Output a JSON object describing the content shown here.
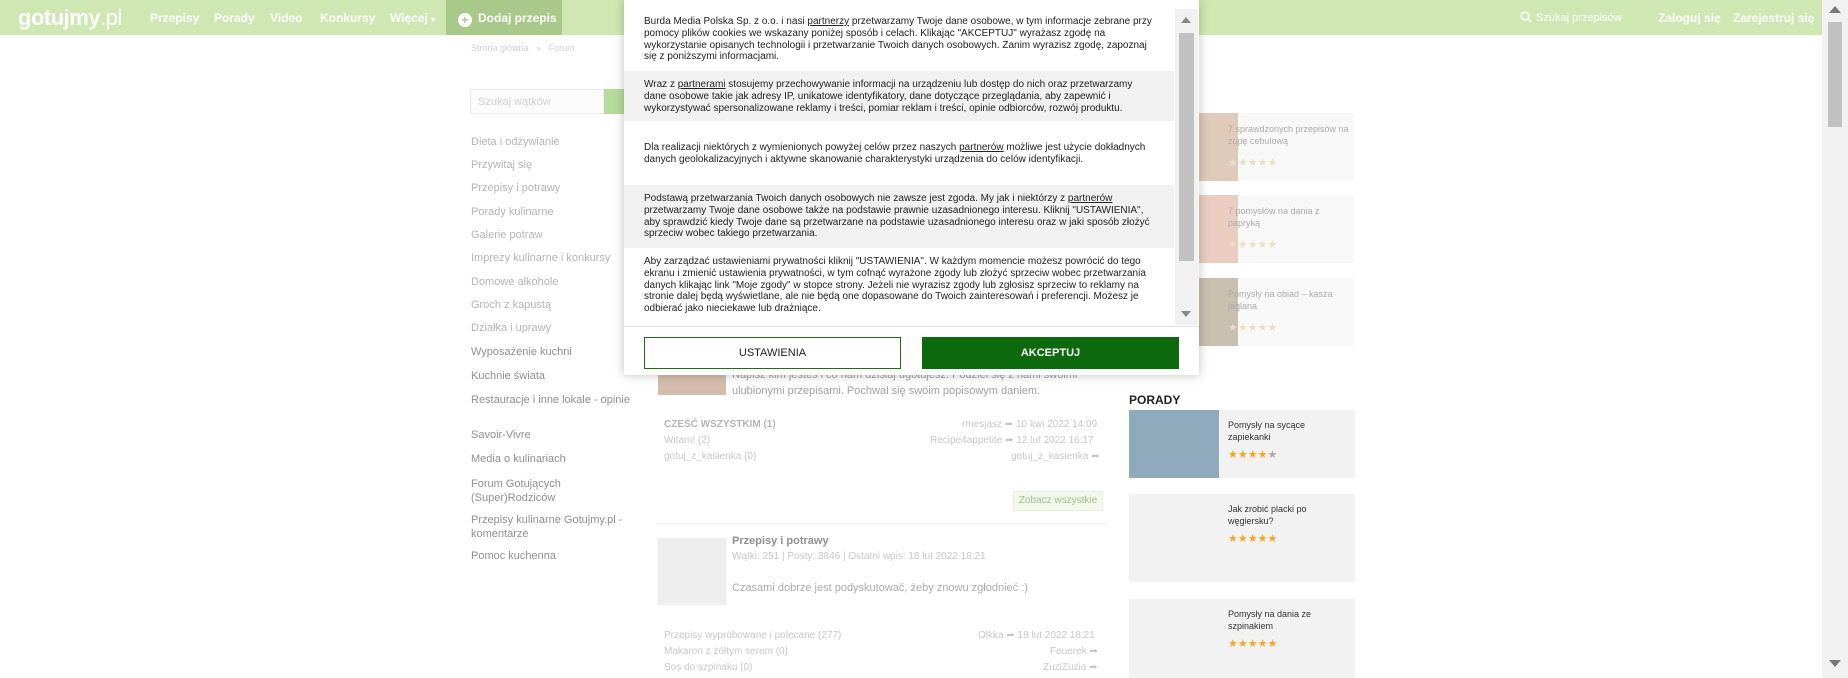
{
  "header": {
    "logo_main": "gotujmy",
    "logo_suffix": ".pl",
    "nav": [
      "Przepisy",
      "Porady",
      "Video",
      "Konkursy",
      "Więcej"
    ],
    "add_recipe": "Dodaj przepis",
    "search_placeholder": "Szukaj przepisów",
    "login": "Zaloguj się",
    "register": "Zarejestruj się"
  },
  "breadcrumb": [
    "Strona główna",
    "»",
    "Forum"
  ],
  "sidebar": {
    "search_placeholder": "Szukaj wątków",
    "categories": [
      "Dieta i odżywianie",
      "Przywitaj się",
      "Przepisy i potrawy",
      "Porady kulinarne",
      "Galerie potraw",
      "Imprezy kulinarne i konkursy",
      "Domowe alkohole",
      "Groch z kapustą",
      "Działka i uprawy",
      "Wyposażenie kuchni",
      "Kuchnie świata",
      "Restauracje i inne lokale - opinie",
      "Savoir-Vivre",
      "Media o kulinariach",
      "Forum Gotujących (Super)Rodziców",
      "Przepisy kulinarne Gotujmy.pl - komentarze",
      "Pomoc kuchenna"
    ]
  },
  "forum": {
    "section1": {
      "desc": "Napisz kim jesteś i co nam dzisiaj ugotujesz. Podziel się z nami swoimi ulubionymi przepisami. Pochwal się swoim popisowym daniem.",
      "threads": [
        {
          "title": "CZEŚĆ WSZYSTKIM",
          "count": "(1)",
          "user": "rmesjasz",
          "date": "10 kwi 2022 14:09"
        },
        {
          "title": "Witam!",
          "count": "(2)",
          "user": "Recipe4appetite",
          "date": "12 lut 2022 16:17"
        },
        {
          "title": "gotuj_z_kasienka",
          "count": "(0)",
          "user": "gotuj_z_kasienka",
          "date": ""
        }
      ],
      "see_all": "Zobacz wszystkie"
    },
    "section2": {
      "title": "Przepisy i potrawy",
      "stats": "Wątki: 251  |  Posty: 3846  |  Ostatni wpis: 18 lut 2022 18:21",
      "desc": "Czasami dobrze jest podyskutować, żeby znowu zgłodnieć :)",
      "threads": [
        {
          "title": "Przepisy wypróbowane i polecane",
          "count": "(277)",
          "user": "Olkka",
          "date": "18 lut 2022 18:21"
        },
        {
          "title": "Makaron z żółtym serem",
          "count": "(0)",
          "user": "Feuerek",
          "date": ""
        },
        {
          "title": "Sos do szpinaku",
          "count": "(0)",
          "user": "ZuziZuzia",
          "date": ""
        }
      ]
    }
  },
  "right": {
    "recipes": [
      {
        "title": "7 sprawdzonych przepisów na zupę cebulową",
        "stars": "★★★★★"
      },
      {
        "title": "7 pomysłów na dania z papryką",
        "stars": "★★★★★"
      },
      {
        "title": "Pomysły na obiad – kasza jaglana",
        "stars": "★★★★★"
      }
    ],
    "porady_label": "PORADY",
    "porady": [
      {
        "title": "Pomysły na sycące zapiekanki",
        "stars_on": "★★★★",
        "stars_off": "★"
      },
      {
        "title": "Jak zrobić placki po węgiersku?",
        "stars_on": "★★★★★",
        "stars_off": ""
      },
      {
        "title": "Pomysły na dania ze szpinakiem",
        "stars_on": "★★★★★",
        "stars_off": ""
      }
    ]
  },
  "consent": {
    "p1_a": "Burda Media Polska Sp. z o.o. i nasi ",
    "p1_link": "partnerzy",
    "p1_b": " przetwarzamy Twoje dane osobowe, w tym informacje zebrane przy pomocy plików cookies we wskazany poniżej sposób i celach. Klikając \"AKCEPTUJ\" wyrażasz zgodę na wykorzystanie opisanych technologii i przetwarzanie Twoich danych osobowych. Zanim wyrazisz zgodę, zapoznaj się z poniższymi informacjami.",
    "p2_a": "Wraz z ",
    "p2_link": "partnerami",
    "p2_b": " stosujemy przechowywanie informacji na urządzeniu lub dostęp do nich oraz przetwarzamy dane osobowe takie jak adresy IP, unikatowe identyfikatory, dane dotyczące przeglądania, aby zapewnić i wykorzystywać spersonalizowane reklamy i treści, pomiar reklam i treści, opinie odbiorców, rozwój produktu.",
    "p3_a": "Dla realizacji niektórych z wymienionych powyżej celów przez naszych ",
    "p3_link": "partnerów",
    "p3_b": " możliwe jest użycie dokładnych danych geolokalizacyjnych i aktywne skanowanie charakterystyki urządzenia do celów identyfikacji.",
    "p4_a": "Podstawą przetwarzania Twoich danych osobowych nie zawsze jest zgoda. My jak i niektórzy z ",
    "p4_link": "partnerów",
    "p4_b": " przetwarzamy Twoje dane osobowe także na podstawie prawnie uzasadnionego interesu. Kliknij \"USTAWIENIA\", aby sprawdzić kiedy Twoje dane są przetwarzane na podstawie uzasadnionego interesu oraz w jaki sposób złożyć sprzeciw wobec takiego przetwarzania.",
    "p5": "Aby zarządzać ustawieniami prywatności kliknij \"USTAWIENIA\". W każdym momencie możesz powrócić do tego ekranu i zmienić ustawienia prywatności, w tym cofnąć wyrażone zgody lub złożyć sprzeciw wobec przetwarzania danych klikając link \"Moje zgody\" w stopce strony. Jeżeli nie wyrazisz zgody lub zgłosisz sprzeciw to reklamy na stronie dalej będą wyświetlane, ale nie będą one dopasowane do Twoich zainteresowań i preferencji. Możesz je odbierać jako nieciekawe lub drażniące.",
    "settings_label": "USTAWIENIA",
    "accept_label": "AKCEPTUJ"
  }
}
